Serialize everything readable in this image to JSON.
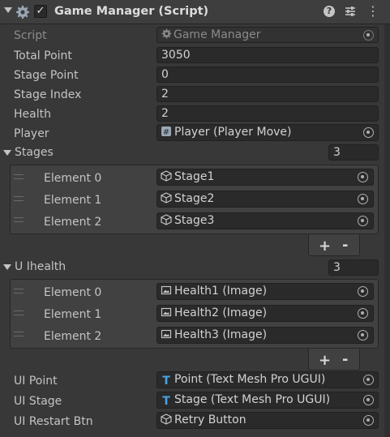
{
  "header": {
    "title": "Game Manager (Script)",
    "checkbox_mark": "✓",
    "help_glyph": "?",
    "more_glyph": "⋮",
    "icons": [
      "gear-icon",
      "help-icon",
      "preset-icon",
      "more-icon"
    ]
  },
  "fields": {
    "script": {
      "label": "Script",
      "value": "Game Manager"
    },
    "total_point": {
      "label": "Total Point",
      "value": "3050"
    },
    "stage_point": {
      "label": "Stage Point",
      "value": "0"
    },
    "stage_index": {
      "label": "Stage Index",
      "value": "2"
    },
    "health": {
      "label": "Health",
      "value": "2"
    },
    "player": {
      "label": "Player",
      "value": "Player (Player Move)"
    }
  },
  "stages": {
    "label": "Stages",
    "count": "3",
    "items": [
      {
        "label": "Element 0",
        "value": "Stage1"
      },
      {
        "label": "Element 1",
        "value": "Stage2"
      },
      {
        "label": "Element 2",
        "value": "Stage3"
      }
    ],
    "add": "+",
    "remove": "-"
  },
  "uihealth": {
    "label": "U Ihealth",
    "count": "3",
    "items": [
      {
        "label": "Element 0",
        "value": "Health1 (Image)"
      },
      {
        "label": "Element 1",
        "value": "Health2 (Image)"
      },
      {
        "label": "Element 2",
        "value": "Health3 (Image)"
      }
    ],
    "add": "+",
    "remove": "-"
  },
  "ui": {
    "point": {
      "label": "UI Point",
      "value": "Point (Text Mesh Pro UGUI)",
      "icon_glyph": "T"
    },
    "stage": {
      "label": "UI Stage",
      "value": "Stage (Text Mesh Pro UGUI)",
      "icon_glyph": "T"
    },
    "restart": {
      "label": "UI Restart Btn",
      "value": "Retry Button"
    }
  },
  "colors": {
    "background": "#383838",
    "field": "#2a2a2a",
    "text": "#c4c4c4",
    "tmp_icon": "#4aa3df"
  }
}
